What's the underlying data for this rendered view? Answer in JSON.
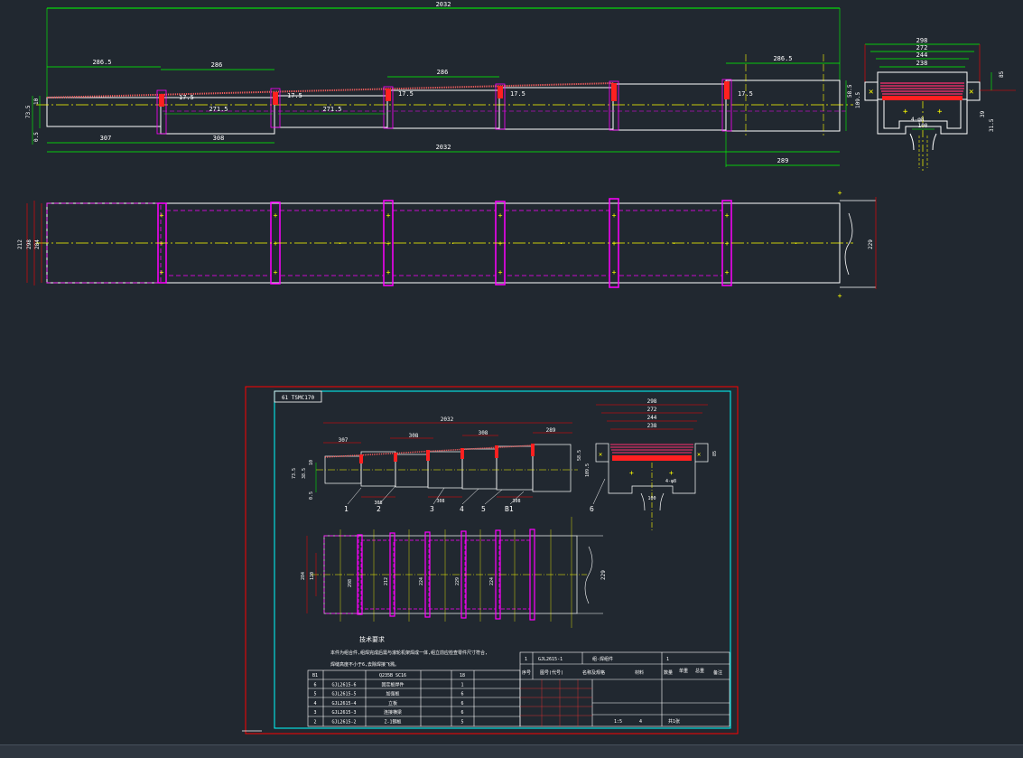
{
  "colors": {
    "background": "#212830",
    "dimension": "#00ff00",
    "outline": "#ff0000",
    "centerline": "#ffff00",
    "hidden": "#ff00ff",
    "white": "#ffffff",
    "frame": "#00ffff"
  },
  "top_view": {
    "overall_top": "2032",
    "overall_bottom": "2032",
    "segment_labels": [
      "286.5",
      "286",
      "286",
      "286.5"
    ],
    "gap_labels": [
      "17.5",
      "17.5",
      "17.5",
      "17.5",
      "17.5"
    ],
    "inner_labels": [
      "271.5",
      "271.5"
    ],
    "bottom_labels": [
      "307",
      "308"
    ],
    "right_bottom": "289",
    "left_vertical": [
      "73.5",
      "10",
      "0.5"
    ],
    "right_vertical": [
      "58.5",
      "109.5"
    ]
  },
  "section_view": {
    "widths": [
      "298",
      "272",
      "244",
      "238"
    ],
    "side_label": "85",
    "right_labels": [
      "39",
      "31.5"
    ],
    "bottom_label": "100",
    "anchor_label": "4-φ8"
  },
  "plan_view": {
    "left_dims": [
      "212",
      "298",
      "284"
    ],
    "right_dim": "229"
  },
  "sheet": {
    "title_tab": "61 TSMC170",
    "mini_top": [
      "2032",
      "307",
      "308",
      "308",
      "289"
    ],
    "mini_left": [
      "73.5",
      "38.5",
      "10",
      "0.5"
    ],
    "mini_right": [
      "58.5",
      "109.5"
    ],
    "mini_bottom": [
      "308",
      "308",
      "308"
    ],
    "part_numbers": [
      "1",
      "2",
      "3",
      "4",
      "5",
      "B1",
      "6"
    ],
    "mini_section": [
      "298",
      "272",
      "244",
      "238",
      "85",
      "100",
      "4-φ8"
    ],
    "mini_plan_left": [
      "284",
      "120"
    ],
    "mini_plan_inner": [
      "298",
      "212",
      "224",
      "229",
      "224"
    ],
    "mini_plan_right": "229",
    "notes_title": "技术要求",
    "notes_line1": "本件为组合件,组焊完成后需与滚轮机架焊成一体,组立前应检查零件尺寸符合,",
    "notes_line2": "焊缝高度不小于6,去除焊接飞溅。",
    "bom_rows": [
      [
        "B1",
        "",
        "Q235B SC16",
        "",
        "18"
      ],
      [
        "6",
        "GJL2615-6",
        "固定板焊件",
        "",
        "1"
      ],
      [
        "5",
        "GJL2615-5",
        "加强板",
        "",
        "6"
      ],
      [
        "4",
        "GJL2615-4",
        "立板",
        "",
        "6"
      ],
      [
        "3",
        "GJL2615-3",
        "连接横梁",
        "",
        "6"
      ],
      [
        "2",
        "GJL2615-2",
        "Z-1钢板",
        "",
        "5"
      ]
    ],
    "title_block": {
      "drawing_no": "GJL2615-1",
      "name": "组-焊组件",
      "headers": [
        "序号",
        "图号(代号)",
        "名称及规格",
        "材料",
        "数量",
        "单重",
        "总重",
        "备注"
      ],
      "scale": "1:5",
      "sheets": "4",
      "page": "共1张"
    }
  }
}
